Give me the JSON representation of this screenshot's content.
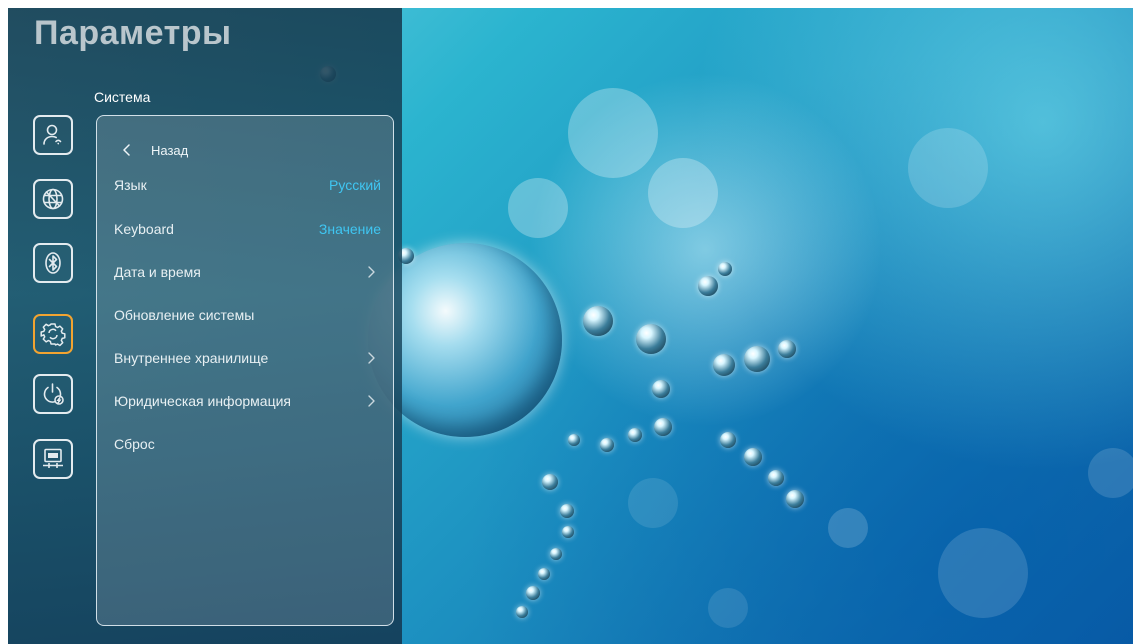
{
  "header": {
    "title": "Параметры"
  },
  "section": {
    "label": "Система"
  },
  "sidebar": {
    "icons": [
      {
        "name": "user-icon",
        "active": false
      },
      {
        "name": "globe-icon",
        "active": false
      },
      {
        "name": "bluetooth-icon",
        "active": false
      },
      {
        "name": "gear-icon",
        "active": true
      },
      {
        "name": "power-icon",
        "active": false
      },
      {
        "name": "projector-icon",
        "active": false
      }
    ]
  },
  "panel": {
    "back_label": "Назад",
    "items": [
      {
        "label": "Язык",
        "value": "Русский",
        "has_arrow": false
      },
      {
        "label": "Keyboard",
        "value": "Значение",
        "has_arrow": false
      },
      {
        "label": "Дата и время",
        "value": "",
        "has_arrow": true
      },
      {
        "label": "Обновление системы",
        "value": "",
        "has_arrow": false
      },
      {
        "label": "Внутреннее хранилище",
        "value": "",
        "has_arrow": true
      },
      {
        "label": "Юридическая информация",
        "value": "",
        "has_arrow": true
      },
      {
        "label": "Сброс",
        "value": "",
        "has_arrow": false
      }
    ]
  },
  "colors": {
    "accent": "#3fc6f2",
    "active_border": "#f2a431",
    "icon_stroke": "#e3ebef"
  }
}
